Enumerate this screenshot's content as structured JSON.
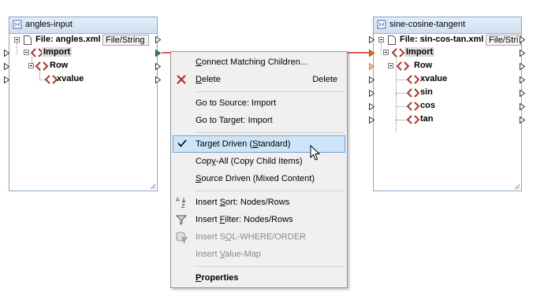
{
  "left_component": {
    "title": "angles-input",
    "file_label": "File: angles.xml",
    "file_button": "File/String",
    "nodes": [
      "Import",
      "Row",
      "xvalue"
    ]
  },
  "right_component": {
    "title": "sine-cosine-tangent",
    "file_label": "File: sin-cos-tan.xml",
    "file_button": "File/Stri",
    "nodes": [
      "Import",
      "Row",
      "xvalue",
      "sin",
      "cos",
      "tan"
    ]
  },
  "context_menu": {
    "items": [
      {
        "pre": "",
        "key": "C",
        "post": "onnect Matching Children...",
        "shortcut": ""
      },
      {
        "pre": "",
        "key": "D",
        "post": "elete",
        "shortcut": "Delete"
      },
      {
        "pre": "Go to Source: Import",
        "key": "",
        "post": "",
        "shortcut": ""
      },
      {
        "pre": "Go to Target: Import",
        "key": "",
        "post": "",
        "shortcut": ""
      },
      {
        "pre": "Target Driven (",
        "key": "S",
        "post": "tandard)",
        "shortcut": ""
      },
      {
        "pre": "Cop",
        "key": "y",
        "post": "-All (Copy Child Items)",
        "shortcut": ""
      },
      {
        "pre": "",
        "key": "S",
        "post": "ource Driven (Mixed Content)",
        "shortcut": ""
      },
      {
        "pre": "Insert ",
        "key": "S",
        "post": "ort: Nodes/Rows",
        "shortcut": ""
      },
      {
        "pre": "Insert ",
        "key": "F",
        "post": "ilter: Nodes/Rows",
        "shortcut": ""
      },
      {
        "pre": "Insert S",
        "key": "Q",
        "post": "L-WHERE/ORDER",
        "shortcut": ""
      },
      {
        "pre": "Insert ",
        "key": "V",
        "post": "alue-Map",
        "shortcut": ""
      },
      {
        "pre": "",
        "key": "P",
        "post": "roperties",
        "shortcut": ""
      }
    ]
  },
  "colors": {
    "connection_line": "#d42020",
    "element_icon": "#b0332a",
    "selection_bg": "#cde5f7",
    "selection_border": "#6fa3d3"
  }
}
